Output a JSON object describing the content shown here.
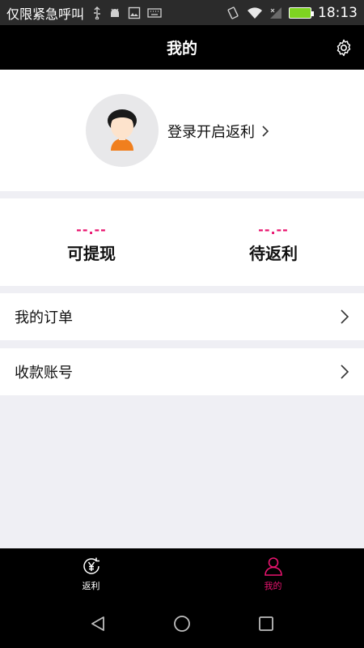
{
  "status_bar": {
    "carrier": "仅限紧急呼叫",
    "time": "18:13",
    "icons": [
      "usb-icon",
      "android-debug-icon",
      "image-icon",
      "keyboard-icon",
      "vibrate-icon",
      "wifi-icon",
      "no-signal-icon",
      "battery-icon"
    ]
  },
  "header": {
    "title": "我的",
    "settings_icon": "gear-icon"
  },
  "profile": {
    "avatar_icon": "avatar",
    "login_text": "登录开启返利"
  },
  "balance": {
    "items": [
      {
        "value": "--.--",
        "label": "可提现"
      },
      {
        "value": "--.--",
        "label": "待返利"
      }
    ]
  },
  "menu": {
    "items": [
      {
        "label": "我的订单"
      },
      {
        "label": "收款账号"
      }
    ]
  },
  "tabs": [
    {
      "label": "返利",
      "icon": "yen-refresh-icon",
      "active": false
    },
    {
      "label": "我的",
      "icon": "person-icon",
      "active": true
    }
  ],
  "colors": {
    "accent": "#e9146f",
    "header_bg": "#000000",
    "page_bg": "#efeff4"
  }
}
